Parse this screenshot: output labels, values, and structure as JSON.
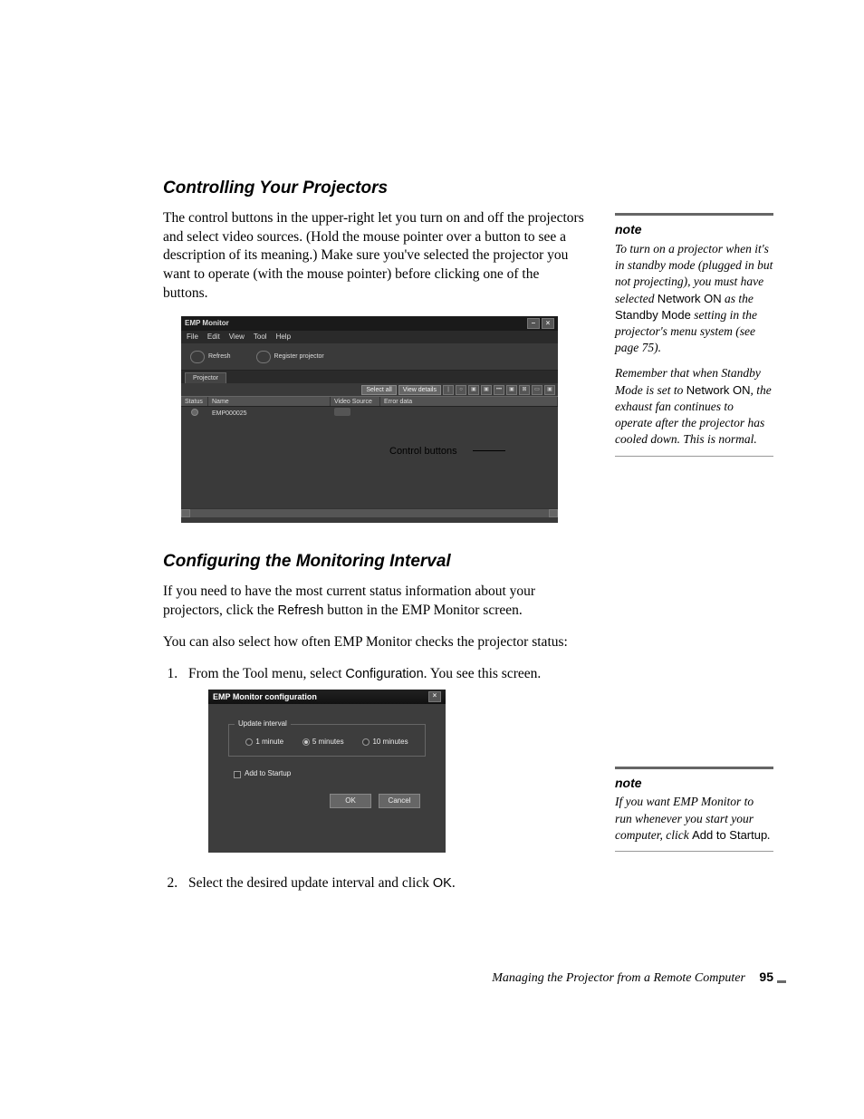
{
  "section1": {
    "heading": "Controlling Your Projectors",
    "para1": "The control buttons in the upper-right let you turn on and off the projectors and select video sources. (Hold the mouse pointer over a button to see a description of its meaning.) Make sure you've selected the projector you want to operate (with the mouse pointer) before clicking one of the buttons."
  },
  "emp_window": {
    "title": "EMP Monitor",
    "menu": {
      "file": "File",
      "edit": "Edit",
      "view": "View",
      "tool": "Tool",
      "help": "Help"
    },
    "toolbar": {
      "refresh": "Refresh",
      "register": "Register projector"
    },
    "tab": "Projector",
    "buttons": {
      "select_all": "Select all",
      "view_details": "View details"
    },
    "columns": {
      "status": "Status",
      "name": "Name",
      "video": "Video Source",
      "error": "Error data"
    },
    "row": {
      "name": "EMP000025"
    },
    "callout": "Control buttons"
  },
  "section2": {
    "heading": "Configuring the Monitoring Interval",
    "para1_a": "If you need to have the most current status information about your projectors, click the ",
    "para1_refresh": "Refresh",
    "para1_b": " button in the EMP Monitor screen.",
    "para2": "You can also select how often EMP Monitor checks the projector status:",
    "step1_a": "From the Tool menu, select ",
    "step1_cfg": "Configuration",
    "step1_b": ". You see this screen.",
    "step2_a": "Select the desired update interval and click ",
    "step2_ok": "OK",
    "step2_b": "."
  },
  "cfg_dialog": {
    "title": "EMP Monitor configuration",
    "group": "Update interval",
    "opts": {
      "m1": "1 minute",
      "m5": "5 minutes",
      "m10": "10 minutes"
    },
    "startup": "Add to Startup",
    "ok": "OK",
    "cancel": "Cancel"
  },
  "note1": {
    "label": "note",
    "p1_a": "To turn on a projector when it's in standby mode (plugged in but not projecting), you must have selected ",
    "p1_net": "Network ON",
    "p1_b": " as the ",
    "p1_sm": "Standby Mode",
    "p1_c": " setting in the projector's menu system (see page 75).",
    "p2_a": "Remember that when Standby Mode is set to ",
    "p2_net": "Network ON",
    "p2_b": ", the exhaust fan continues to operate after the projector has cooled down. This is normal."
  },
  "note2": {
    "label": "note",
    "p_a": "If you want EMP Monitor to run whenever you start your computer, click ",
    "p_add": "Add to Startup",
    "p_b": "."
  },
  "footer": {
    "text": "Managing the Projector from a Remote Computer",
    "page": "95"
  }
}
